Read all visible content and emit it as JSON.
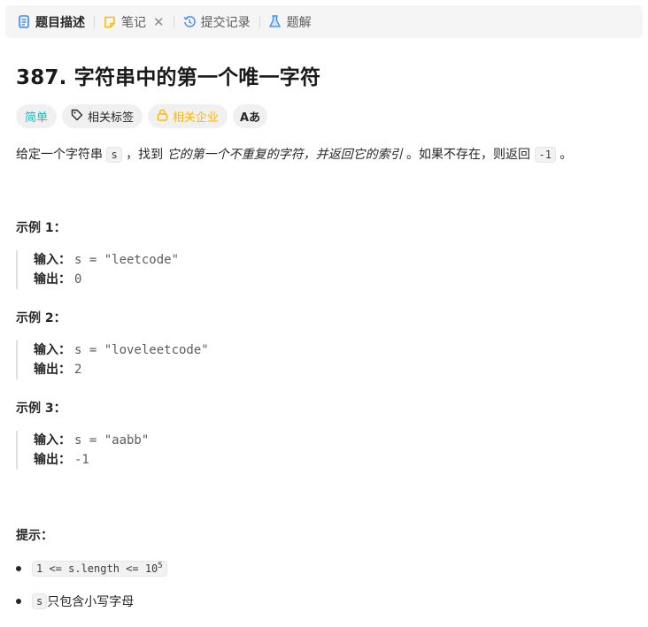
{
  "tabs": [
    {
      "label": "题目描述",
      "icon": "description-icon",
      "active": true
    },
    {
      "label": "笔记",
      "icon": "note-icon",
      "active": false
    },
    {
      "label": "提交记录",
      "icon": "history-icon",
      "active": false
    },
    {
      "label": "题解",
      "icon": "flask-icon",
      "active": false
    }
  ],
  "close_symbol": "✕",
  "problem": {
    "title": "387. 字符串中的第一个唯一字符"
  },
  "tags": {
    "difficulty": "简单",
    "related_tags": "相关标签",
    "related_companies": "相关企业",
    "translate": "Aあ"
  },
  "description": {
    "p1": "给定一个字符串 ",
    "code_s": "s",
    "p2": " ，找到 ",
    "emph": "它的第一个不重复的字符，并返回它的索引",
    "p3": " 。如果不存在，则返回 ",
    "code_neg": "-1",
    "p4": " 。"
  },
  "examples": [
    {
      "title": "示例 1：",
      "input_label": "输入：",
      "input": "s = \"leetcode\"",
      "output_label": "输出：",
      "output": "0"
    },
    {
      "title": "示例 2：",
      "input_label": "输入：",
      "input": "s = \"loveleetcode\"",
      "output_label": "输出：",
      "output": "2"
    },
    {
      "title": "示例 3：",
      "input_label": "输入：",
      "input": "s = \"aabb\"",
      "output_label": "输出：",
      "output": "-1"
    }
  ],
  "hints": {
    "title": "提示：",
    "c1_code": "1 <= s.length <= 10",
    "c1_sup": "5",
    "c2_code": "s",
    "c2_text": " 只包含小写字母"
  },
  "colors": {
    "easy": "#1cb8b8",
    "company": "#ffb800",
    "tab_icon_blue": "#3a86ff",
    "note_icon": "#ffb800"
  }
}
